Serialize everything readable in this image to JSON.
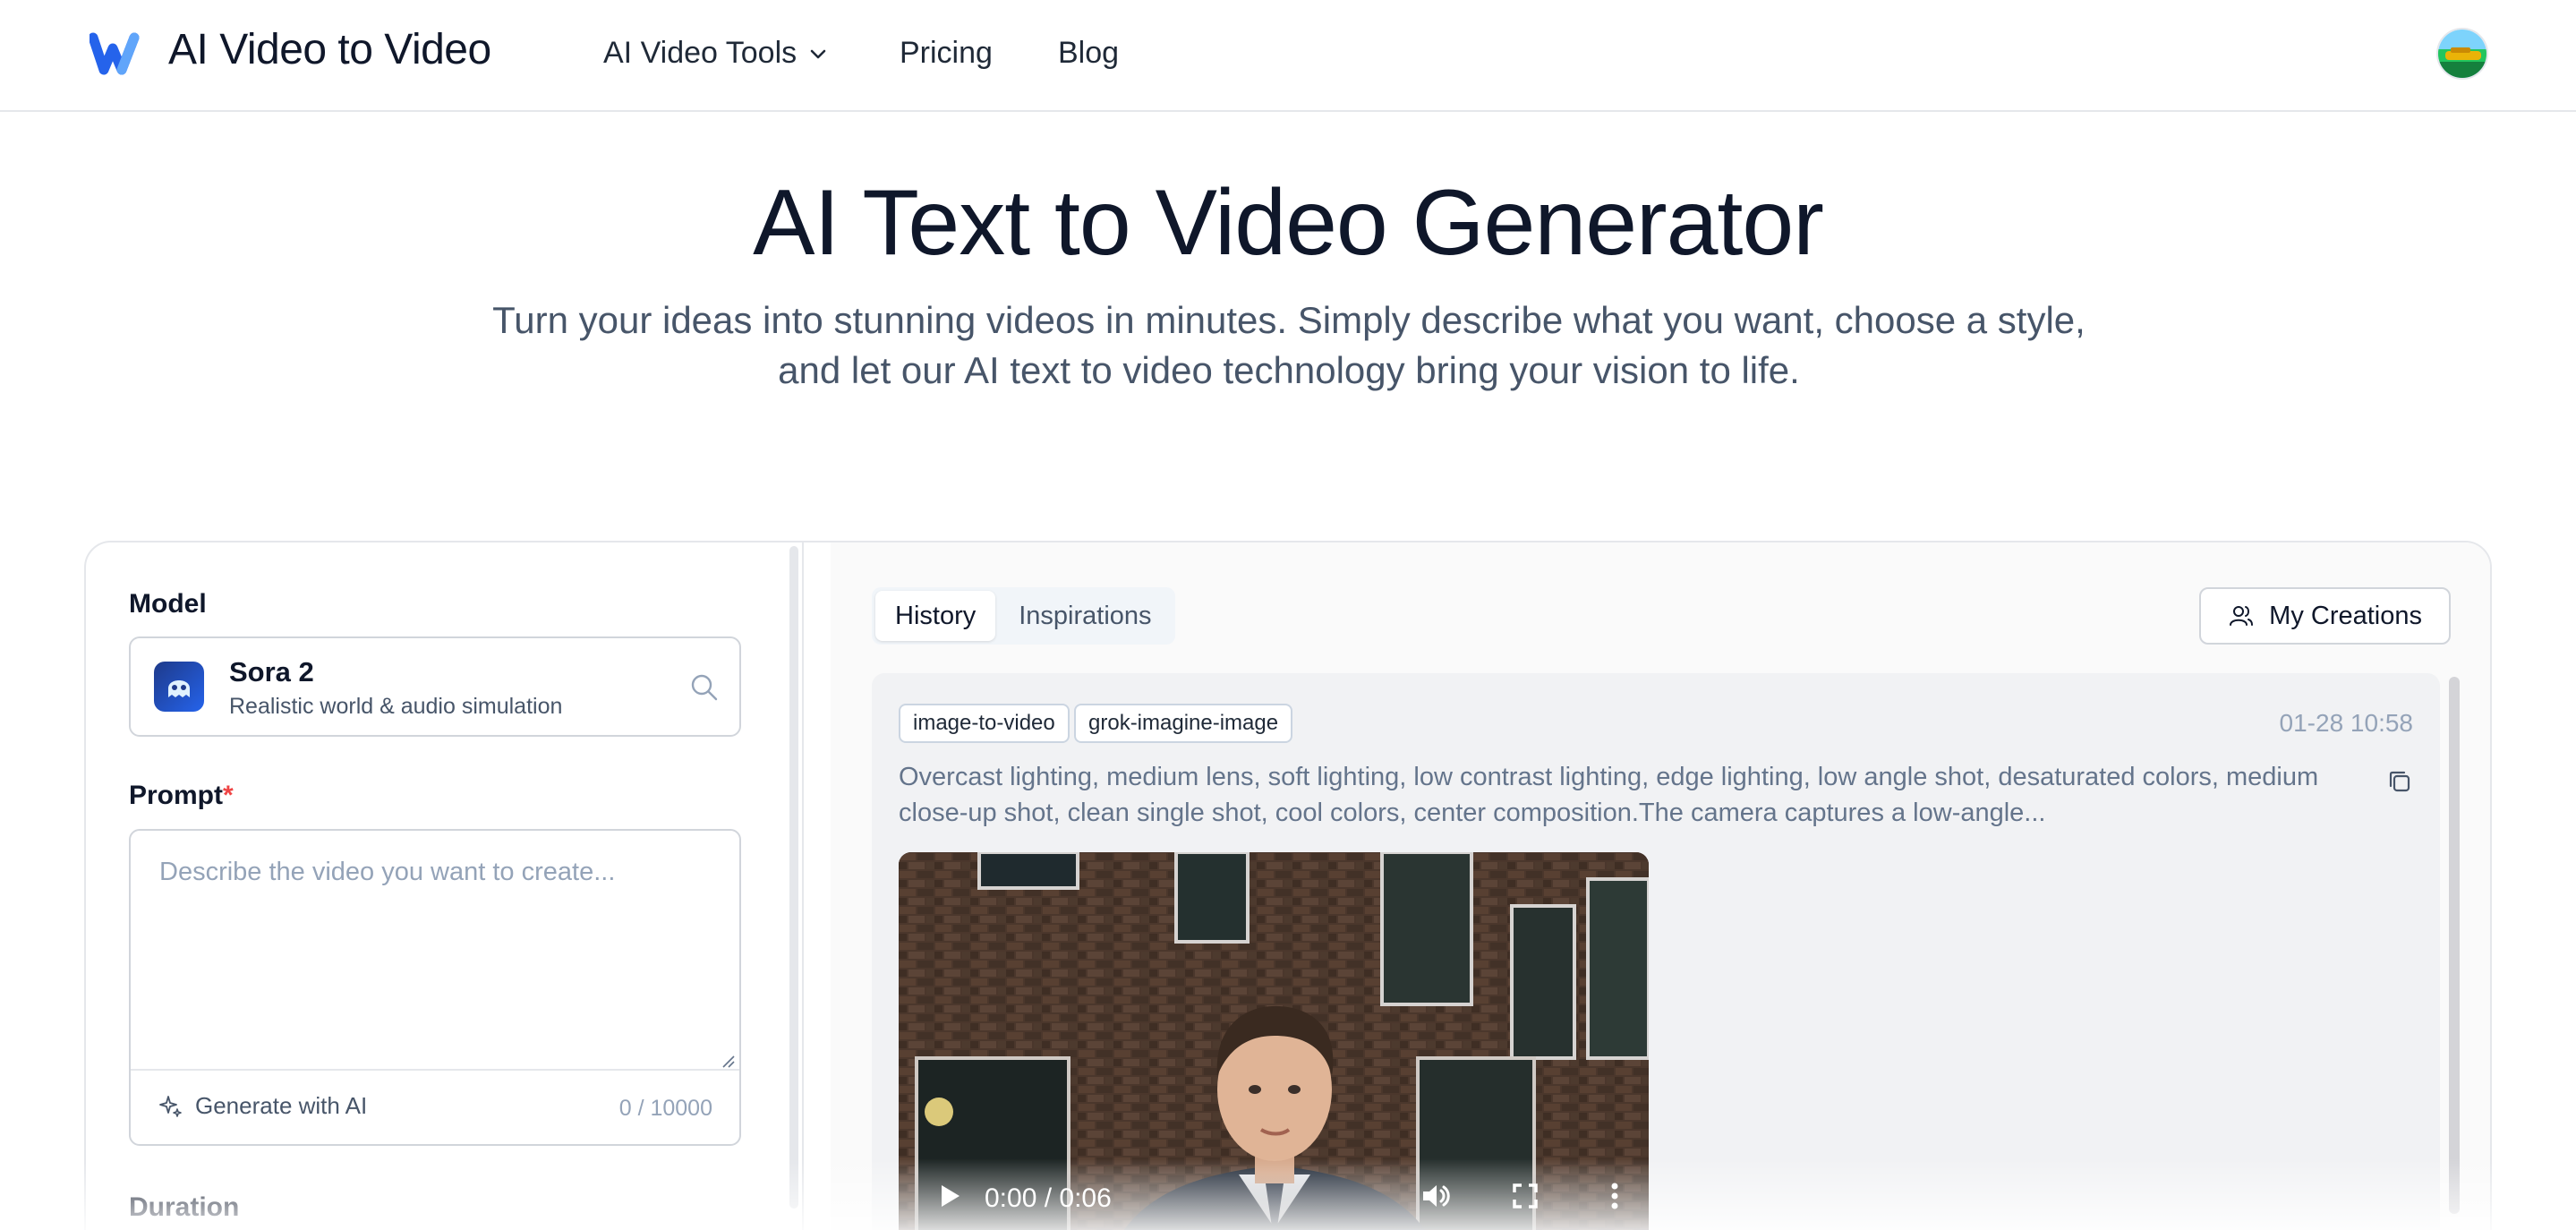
{
  "header": {
    "brand": "AI Video to Video",
    "nav": {
      "tools_label": "AI Video Tools",
      "pricing_label": "Pricing",
      "blog_label": "Blog"
    }
  },
  "hero": {
    "title": "AI Text to Video Generator",
    "subtitle": "Turn your ideas into stunning videos in minutes. Simply describe what you want, choose a style, and let our AI text to video technology bring your vision to life."
  },
  "form": {
    "model_label": "Model",
    "model": {
      "name": "Sora 2",
      "description": "Realistic world & audio simulation"
    },
    "prompt_label": "Prompt",
    "prompt_required_marker": "*",
    "prompt_placeholder": "Describe the video you want to create...",
    "prompt_value": "",
    "generate_ai_label": "Generate with AI",
    "char_count": "0 / 10000",
    "duration_label": "Duration"
  },
  "results": {
    "tabs": [
      {
        "label": "History",
        "active": true
      },
      {
        "label": "Inspirations",
        "active": false
      }
    ],
    "my_creations_label": "My Creations",
    "history_item": {
      "tags": [
        "image-to-video",
        "grok-imagine-image"
      ],
      "timestamp": "01-28 10:58",
      "description": "Overcast lighting, medium lens, soft lighting, low contrast lighting, edge lighting, low angle shot, desaturated colors, medium close-up shot, clean single shot, cool colors, center composition.The camera captures a low-angle...",
      "video_time": "0:00 / 0:06"
    }
  },
  "colors": {
    "logo_blue": "#2563eb",
    "required_red": "#ef4444",
    "text_primary": "#0f172a",
    "text_muted": "#64748b"
  },
  "icons": [
    "logo-icon",
    "chevron-down-icon",
    "avatar-image",
    "search-icon",
    "sparkle-icon",
    "users-icon",
    "copy-icon",
    "play-icon",
    "volume-icon",
    "fullscreen-icon",
    "more-vertical-icon"
  ]
}
